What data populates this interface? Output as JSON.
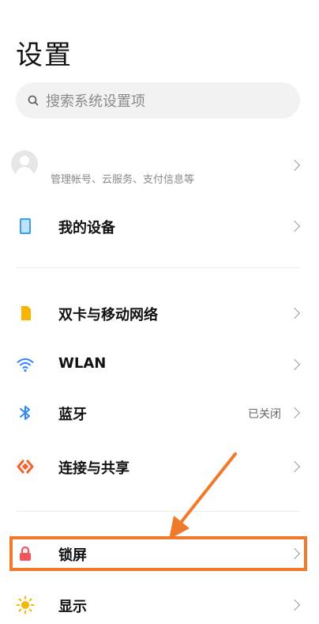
{
  "header": {
    "title": "设置"
  },
  "search": {
    "placeholder": "搜索系统设置项",
    "icon": "search-icon"
  },
  "account": {
    "subtitle": "管理帐号、云服务、支付信息等"
  },
  "items": [
    {
      "label": "我的设备",
      "icon": "device-icon",
      "icon_color": "#3aa0ef"
    },
    {
      "label": "双卡与移动网络",
      "icon": "sim-card-icon",
      "icon_color": "#f7b500"
    },
    {
      "label": "WLAN",
      "icon": "wifi-icon",
      "icon_color": "#2f86f6"
    },
    {
      "label": "蓝牙",
      "value": "已关闭",
      "icon": "bluetooth-icon",
      "icon_color": "#2f86f6"
    },
    {
      "label": "连接与共享",
      "icon": "share-icon",
      "icon_color": "#f0652f"
    },
    {
      "label": "锁屏",
      "icon": "lock-icon",
      "icon_color": "#f2545b"
    },
    {
      "label": "显示",
      "icon": "sun-icon",
      "icon_color": "#f7b500"
    }
  ],
  "annotation": {
    "color": "#f07a2a"
  }
}
